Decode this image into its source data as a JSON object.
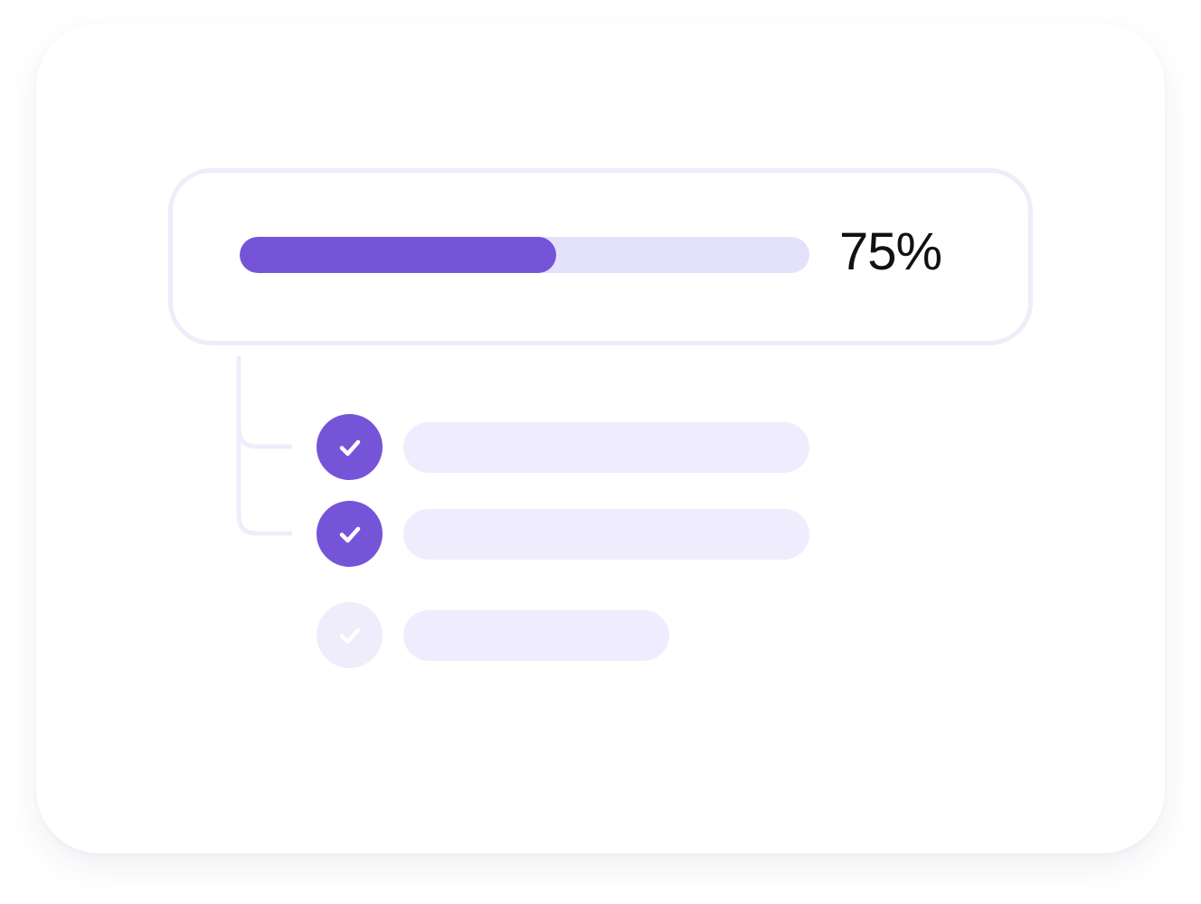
{
  "progress": {
    "value": 0.75,
    "label": "75%"
  },
  "tasks": [
    {
      "status": "complete"
    },
    {
      "status": "complete"
    },
    {
      "status": "pending"
    }
  ],
  "colors": {
    "accent": "#7654d8",
    "track": "#e4e2fa",
    "placeholder": "#efedfd",
    "pending": "#efecfb",
    "text": "#111111"
  },
  "icons": {
    "task_status": "check-icon"
  }
}
